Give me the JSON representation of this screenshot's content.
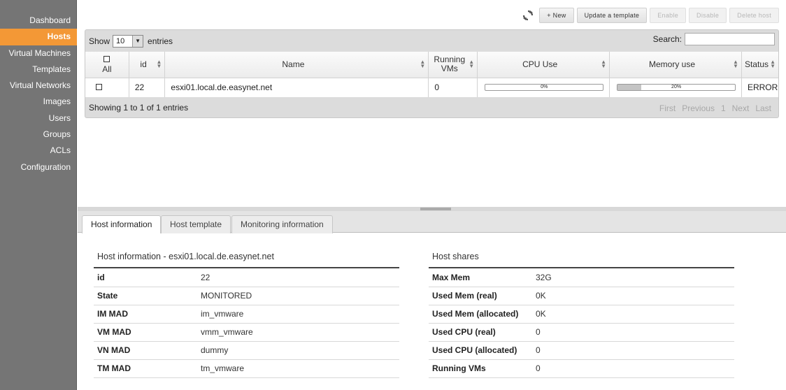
{
  "sidebar": {
    "items": [
      {
        "label": "Dashboard"
      },
      {
        "label": "Hosts",
        "active": true
      },
      {
        "label": "Virtual Machines"
      },
      {
        "label": "Templates"
      },
      {
        "label": "Virtual Networks"
      },
      {
        "label": "Images"
      },
      {
        "label": "Users"
      },
      {
        "label": "Groups"
      },
      {
        "label": "ACLs"
      },
      {
        "label": "Configuration"
      }
    ]
  },
  "toolbar": {
    "refresh_icon": "refresh-icon",
    "new_label": "+ New",
    "update_template_label": "Update a template",
    "enable_label": "Enable",
    "disable_label": "Disable",
    "delete_label": "Delete host"
  },
  "table": {
    "show_label": "Show",
    "entries_value": "10",
    "entries_label": "entries",
    "search_label": "Search:",
    "search_value": "",
    "columns": {
      "all": "All",
      "id": "id",
      "name": "Name",
      "running_vms_1": "Running",
      "running_vms_2": "VMs",
      "cpu_use": "CPU Use",
      "memory_use": "Memory use",
      "status": "Status"
    },
    "rows": [
      {
        "id": "22",
        "name": "esxi01.local.de.easynet.net",
        "running_vms": "0",
        "cpu_pct": "0%",
        "cpu_fraction": 0,
        "mem_pct": "20%",
        "mem_fraction": 0.2,
        "status": "ERROR"
      }
    ],
    "footer_info": "Showing 1 to 1 of 1 entries",
    "pager": {
      "first": "First",
      "previous": "Previous",
      "page": "1",
      "next": "Next",
      "last": "Last"
    }
  },
  "tabs": {
    "host_information": "Host information",
    "host_template": "Host template",
    "monitoring_information": "Monitoring information"
  },
  "host_info": {
    "title": "Host information - esxi01.local.de.easynet.net",
    "rows": [
      {
        "key": "id",
        "value": "22"
      },
      {
        "key": "State",
        "value": "MONITORED"
      },
      {
        "key": "IM MAD",
        "value": "im_vmware"
      },
      {
        "key": "VM MAD",
        "value": "vmm_vmware"
      },
      {
        "key": "VN MAD",
        "value": "dummy"
      },
      {
        "key": "TM MAD",
        "value": "tm_vmware"
      }
    ]
  },
  "host_shares": {
    "title": "Host shares",
    "rows": [
      {
        "key": "Max Mem",
        "value": "32G"
      },
      {
        "key": "Used Mem (real)",
        "value": "0K"
      },
      {
        "key": "Used Mem (allocated)",
        "value": "0K"
      },
      {
        "key": "Used CPU (real)",
        "value": "0"
      },
      {
        "key": "Used CPU (allocated)",
        "value": "0"
      },
      {
        "key": "Running VMs",
        "value": "0"
      }
    ]
  }
}
